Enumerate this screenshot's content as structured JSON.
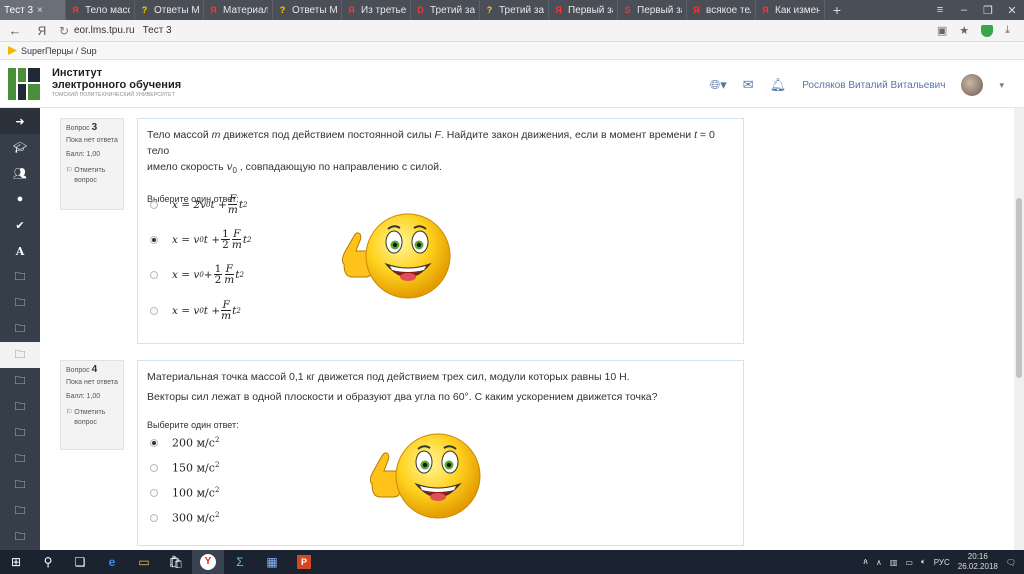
{
  "browser": {
    "tabs": [
      {
        "label": "Тест 3",
        "fav": "",
        "active": true
      },
      {
        "label": "Тело массой",
        "fav": "Я",
        "color": "#ff3333"
      },
      {
        "label": "Ответы Mail",
        "fav": "?",
        "color": "#ffd200"
      },
      {
        "label": "Материальн",
        "fav": "Я",
        "color": "#ff3333"
      },
      {
        "label": "Ответы Mail",
        "fav": "?",
        "color": "#ffd200"
      },
      {
        "label": "Из третьего",
        "fav": "Я",
        "color": "#ff3333"
      },
      {
        "label": "Третий зако",
        "fav": "D",
        "color": "#e23b3b"
      },
      {
        "label": "Третий зако",
        "fav": "?",
        "color": "#ffd200"
      },
      {
        "label": "Первый зак",
        "fav": "Я",
        "color": "#ff3333"
      },
      {
        "label": "Первый зак",
        "fav": "S",
        "color": "#e23b3b"
      },
      {
        "label": "всякое тело",
        "fav": "Я",
        "color": "#ff3333"
      },
      {
        "label": "Как изменит",
        "fav": "Я",
        "color": "#ff3333"
      }
    ],
    "new_tab": "+",
    "address": {
      "url": "eor.lms.tpu.ru",
      "page_title": "Тест 3",
      "ya": "Я"
    },
    "bookmarks": [
      {
        "label": "SuperПерцы / Sup"
      }
    ]
  },
  "site": {
    "logo_title_1": "Институт",
    "logo_title_2": "электронного обучения",
    "logo_sub": "ТОМСКИЙ ПОЛИТЕХНИЧЕСКИЙ УНИВЕРСИТЕТ",
    "user_name": "Росляков Виталий Витальевич"
  },
  "questions": [
    {
      "label": "Вопрос",
      "number": "3",
      "status": "Пока нет ответа",
      "score": "Балл: 1,00",
      "flag": "Отметить вопрос",
      "text_a": "Тело массой ",
      "text_m": "m",
      "text_b": " движется под действием постоянной силы ",
      "text_F": "F",
      "text_c": ". Найдите закон движения, если в момент времени ",
      "text_t": "t",
      "text_d": " = 0 тело",
      "text_e": "имело скорость ",
      "text_v": "v",
      "text_v_sub": "0",
      "text_f": " , совпадающую по направлению с силой.",
      "choose": "Выберите один ответ:",
      "selected_index": 1
    },
    {
      "label": "Вопрос",
      "number": "4",
      "status": "Пока нет ответа",
      "score": "Балл: 1,00",
      "flag": "Отметить вопрос",
      "text_1": "Материальная точка массой 0,1 кг движется под действием трех сил, модули которых равны 10 Н.",
      "text_2": "Векторы сил лежат в одной плоскости и образуют два угла по 60°. С каким ускорением движется точка?",
      "choose": "Выберите один ответ:",
      "options": [
        {
          "value": "200",
          "unit": "м/с",
          "exp": "2",
          "checked": true
        },
        {
          "value": "150",
          "unit": "м/с",
          "exp": "2"
        },
        {
          "value": "100",
          "unit": "м/с",
          "exp": "2"
        },
        {
          "value": "300",
          "unit": "м/с",
          "exp": "2"
        }
      ]
    }
  ],
  "taskbar": {
    "lang": "РУС",
    "time": "20:16",
    "date": "26.02.2018"
  },
  "colors": {
    "sidebar": "#363e4a",
    "tabbar": "#4a4e57",
    "link": "#5577aa",
    "question_border": "#cfe3f0"
  }
}
